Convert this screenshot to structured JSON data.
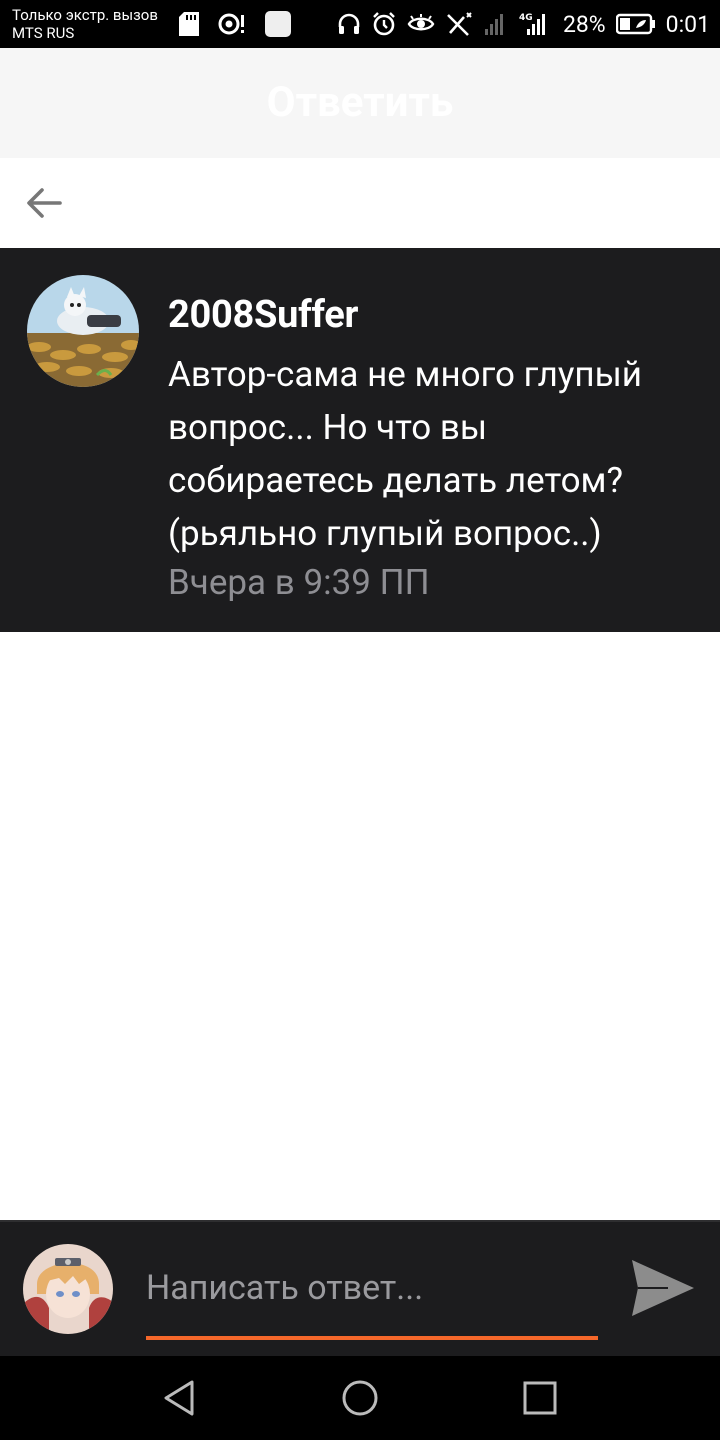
{
  "status_bar": {
    "carrier_line1": "Только экстр. вызов",
    "carrier_line2": "MTS RUS",
    "network": "4G",
    "battery": "28%",
    "time": "0:01",
    "icons_left": [
      "sd-card-icon",
      "nfc-icon",
      "notification-square-icon"
    ],
    "icons_right": [
      "headset-icon",
      "alarm-icon",
      "eye-icon",
      "wifi-off-icon",
      "signal-icon",
      "battery-icon"
    ]
  },
  "header": {
    "title": "Ответить"
  },
  "comment": {
    "username": "2008Suffer",
    "text": "Автор-сама не много глупый вопрос... Но что вы собираетесь делать летом? (рьяльно глупый вопрос..)",
    "time": "Вчера в 9:39 ПП"
  },
  "compose": {
    "placeholder": "Написать ответ...",
    "accent_color": "#f5672a"
  },
  "nav_bar": {
    "buttons": [
      "back-triangle-icon",
      "home-circle-icon",
      "recents-square-icon"
    ]
  }
}
